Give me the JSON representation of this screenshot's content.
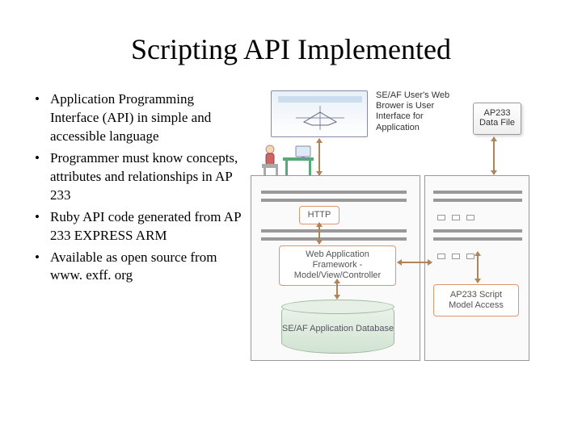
{
  "title": "Scripting API Implemented",
  "bullets": [
    "Application Programming Interface (API) in simple and accessible language",
    "Programmer must know concepts, attributes and relationships in AP 233",
    "Ruby API code generated from AP 233 EXPRESS ARM",
    "Available as open source from www. exff. org"
  ],
  "diagram": {
    "user_text": "SE/AF User's Web Brower is User Interface for Application",
    "data_file": "AP233 Data File",
    "http": "HTTP",
    "waf": "Web Application Framework - Model/View/Controller",
    "db": "SE/AF Application Database",
    "script": "AP233 Script Model Access"
  }
}
